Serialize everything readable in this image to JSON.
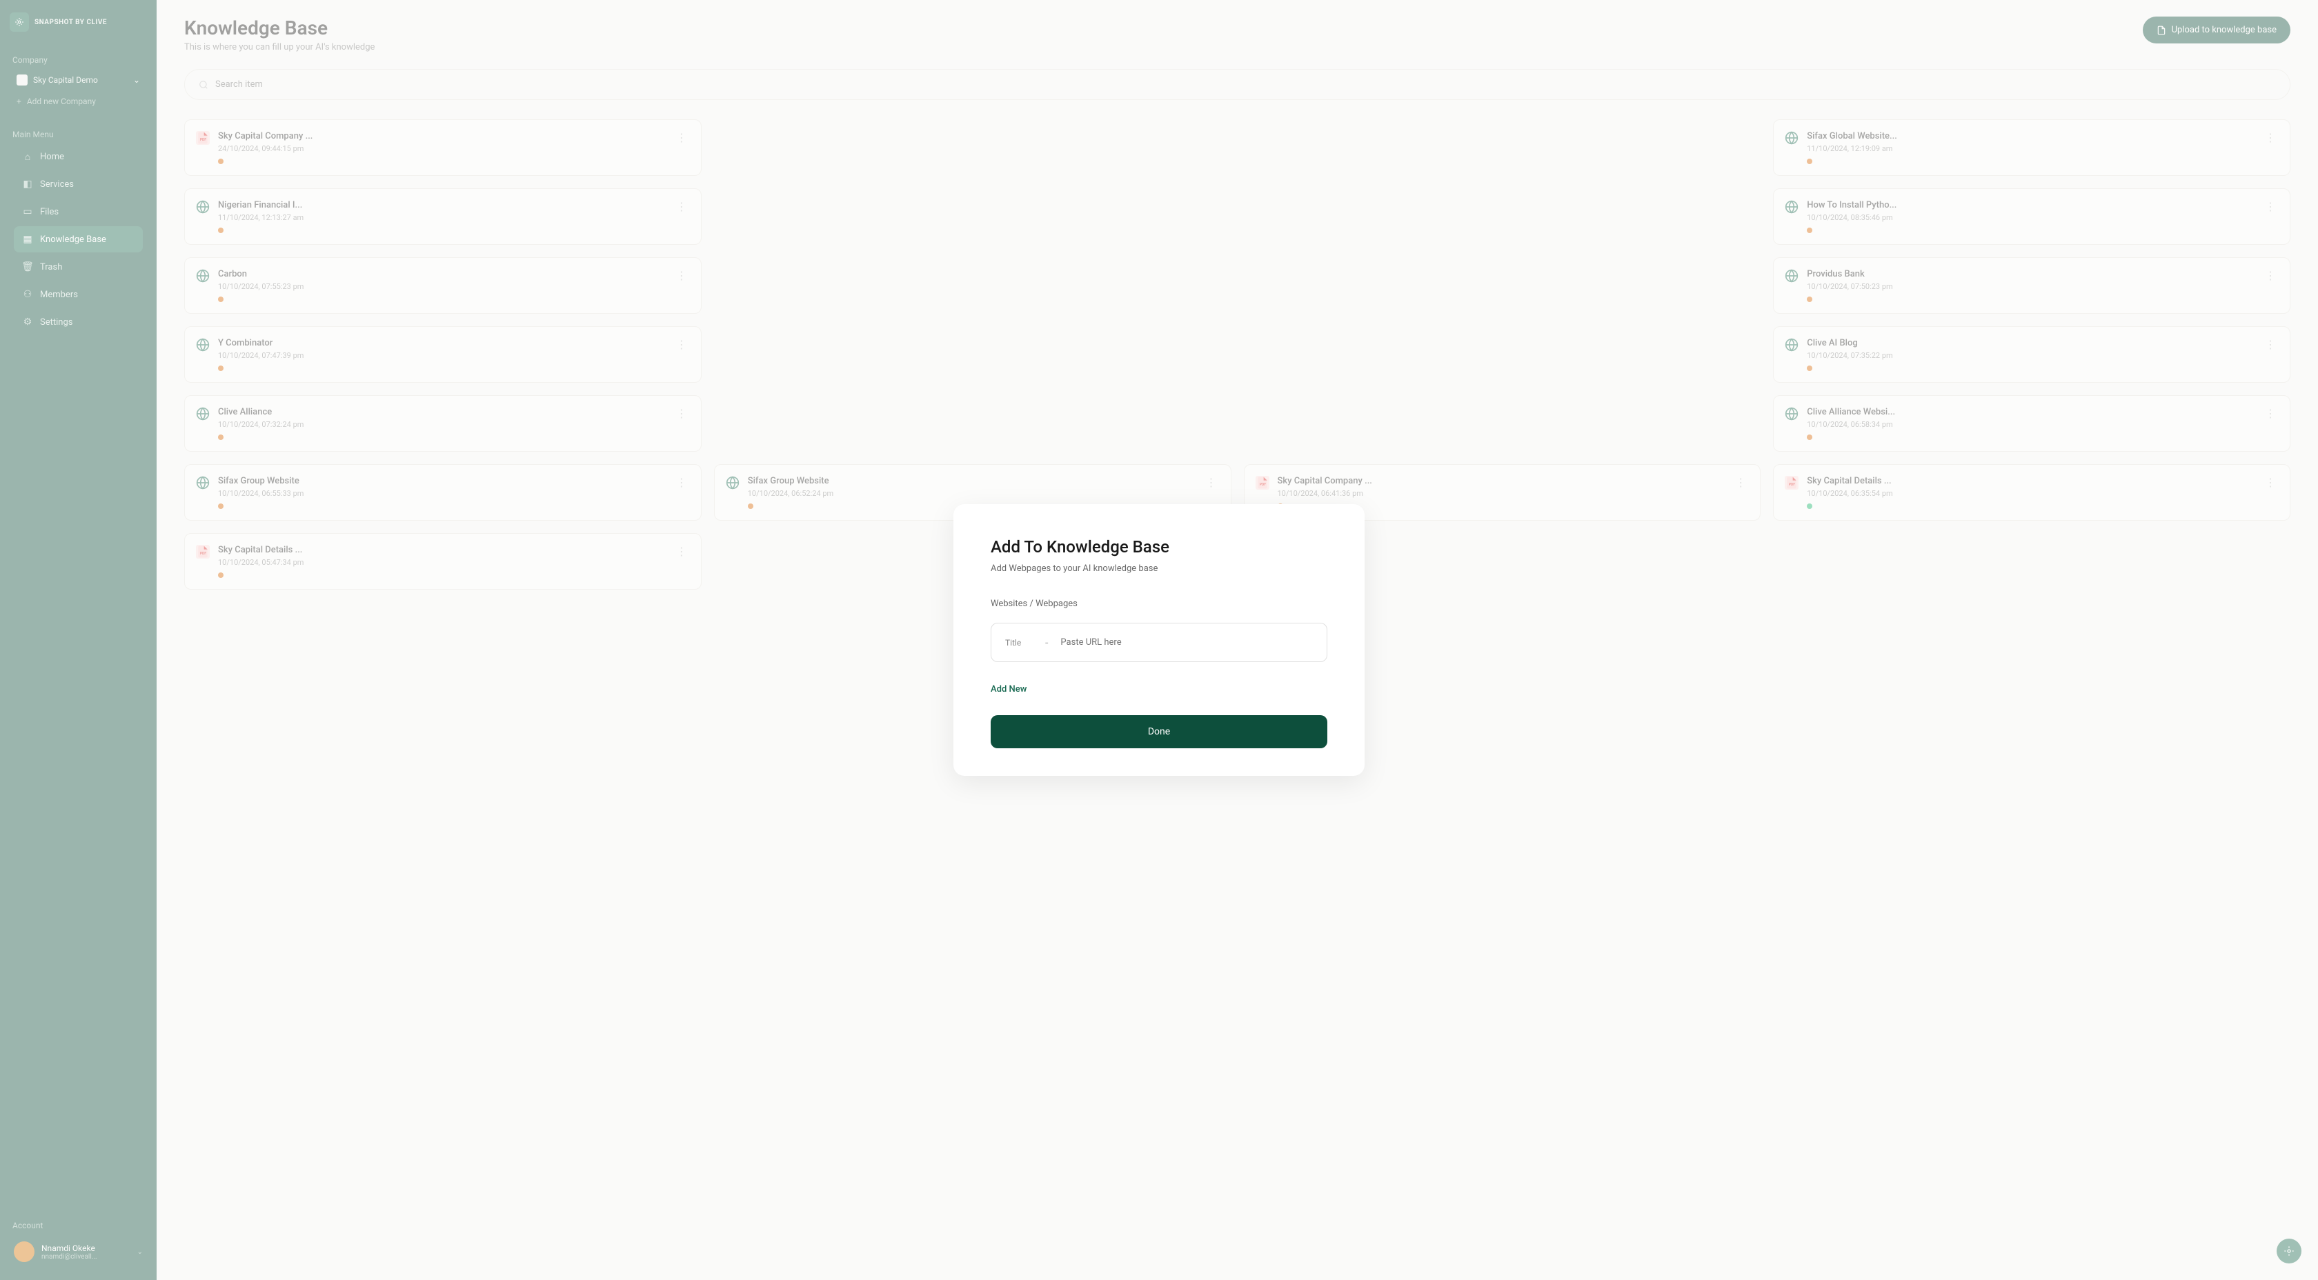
{
  "brand": "SNAPSHOT BY CLIVE",
  "sidebar": {
    "company_label": "Company",
    "company_name": "Sky Capital Demo",
    "add_company": "Add new Company",
    "menu_label": "Main Menu",
    "items": [
      {
        "label": "Home"
      },
      {
        "label": "Services"
      },
      {
        "label": "Files"
      },
      {
        "label": "Knowledge Base"
      },
      {
        "label": "Trash"
      },
      {
        "label": "Members"
      },
      {
        "label": "Settings"
      }
    ],
    "account_label": "Account",
    "user_name": "Nnamdi Okeke",
    "user_email": "nnamdi@cliveall..."
  },
  "header": {
    "title": "Knowledge Base",
    "subtitle": "This is where you can fill up your AI's knowledge",
    "upload": "Upload to knowledge base"
  },
  "search_placeholder": "Search item",
  "cards": [
    {
      "title": "Sky Capital Company ...",
      "date": "24/10/2024, 09:44:15 pm",
      "type": "pdf",
      "status": "red"
    },
    {
      "title": "Sifax Global Website...",
      "date": "11/10/2024, 12:19:09 am",
      "type": "web",
      "status": "red"
    },
    {
      "title": "Nigerian Financial I...",
      "date": "11/10/2024, 12:13:27 am",
      "type": "web",
      "status": "red"
    },
    {
      "title": "How To Install Pytho...",
      "date": "10/10/2024, 08:35:46 pm",
      "type": "web",
      "status": "red"
    },
    {
      "title": "Carbon",
      "date": "10/10/2024, 07:55:23 pm",
      "type": "web",
      "status": "red"
    },
    {
      "title": "Providus Bank",
      "date": "10/10/2024, 07:50:23 pm",
      "type": "web",
      "status": "red"
    },
    {
      "title": "Y Combinator",
      "date": "10/10/2024, 07:47:39 pm",
      "type": "web",
      "status": "red"
    },
    {
      "title": "Clive AI Blog",
      "date": "10/10/2024, 07:35:22 pm",
      "type": "web",
      "status": "red"
    },
    {
      "title": "Clive Alliance",
      "date": "10/10/2024, 07:32:24 pm",
      "type": "web",
      "status": "red"
    },
    {
      "title": "Clive Alliance Websi...",
      "date": "10/10/2024, 06:58:34 pm",
      "type": "web",
      "status": "red"
    },
    {
      "title": "Sifax Group Website",
      "date": "10/10/2024, 06:55:33 pm",
      "type": "web",
      "status": "red"
    },
    {
      "title": "Sifax Group Website",
      "date": "10/10/2024, 06:52:24 pm",
      "type": "web",
      "status": "red"
    },
    {
      "title": "Sky Capital Company ...",
      "date": "10/10/2024, 06:41:36 pm",
      "type": "pdf",
      "status": "red"
    },
    {
      "title": "Sky Capital Details ...",
      "date": "10/10/2024, 06:35:54 pm",
      "type": "pdf",
      "status": "green"
    },
    {
      "title": "Sky Capital Details ...",
      "date": "10/10/2024, 05:47:34 pm",
      "type": "pdf",
      "status": "red"
    }
  ],
  "modal": {
    "title": "Add To Knowledge Base",
    "subtitle": "Add Webpages to your AI knowledge base",
    "section": "Websites / Webpages",
    "title_label": "Title",
    "url_placeholder": "Paste URL here",
    "add_new": "Add New",
    "done": "Done"
  }
}
